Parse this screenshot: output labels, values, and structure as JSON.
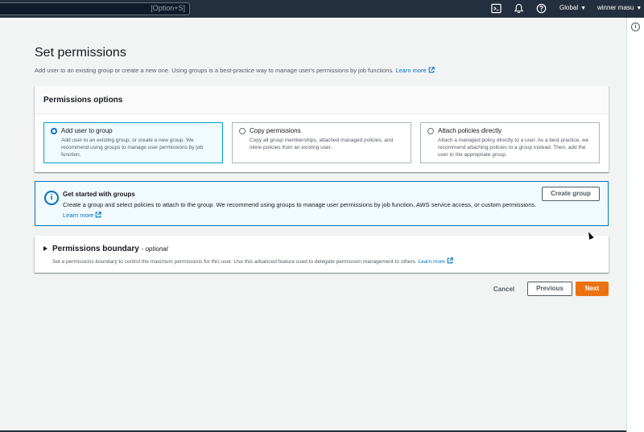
{
  "topnav": {
    "search_shortcut": "[Option+S]",
    "icons": [
      "cloudshell-icon",
      "bell-icon",
      "help-icon"
    ],
    "region": "Global",
    "user": "winner masu"
  },
  "page": {
    "title": "Set permissions",
    "description": "Add user to an existing group or create a new one. Using groups is a best-practice way to manage user's permissions by job functions.",
    "learn_more": "Learn more"
  },
  "options": {
    "title": "Permissions options",
    "selected": "add-user-to-group",
    "tiles": [
      {
        "title": "Add user to group",
        "desc": "Add user to an existing group, or create a new group. We recommend using groups to manage user permissions by job function."
      },
      {
        "title": "Copy permissions",
        "desc": "Copy all group memberships, attached managed policies, and inline policies from an existing user."
      },
      {
        "title": "Attach policies directly",
        "desc": "Attach a managed policy directly to a user. As a best practice, we recommend attaching policies to a group instead. Then, add the user to the appropriate group."
      }
    ]
  },
  "alert": {
    "title": "Get started with groups",
    "text": "Create a group and select policies to attach to the group. We recommend using groups to manage user permissions by job function, AWS service access, or custom permissions.",
    "learn_more": "Learn more",
    "button": "Create group"
  },
  "boundary": {
    "title": "Permissions boundary",
    "optional": "- optional",
    "desc": "Set a permissions boundary to control the maximum permissions for this user. Use this advanced feature used to delegate permission management to others.",
    "learn_more": "Learn more"
  },
  "actions": {
    "cancel": "Cancel",
    "previous": "Previous",
    "next": "Next"
  },
  "colors": {
    "nav_bg": "#232f3e",
    "link": "#0073bb",
    "primary": "#ec7211",
    "selected_bg": "#f1faff"
  }
}
